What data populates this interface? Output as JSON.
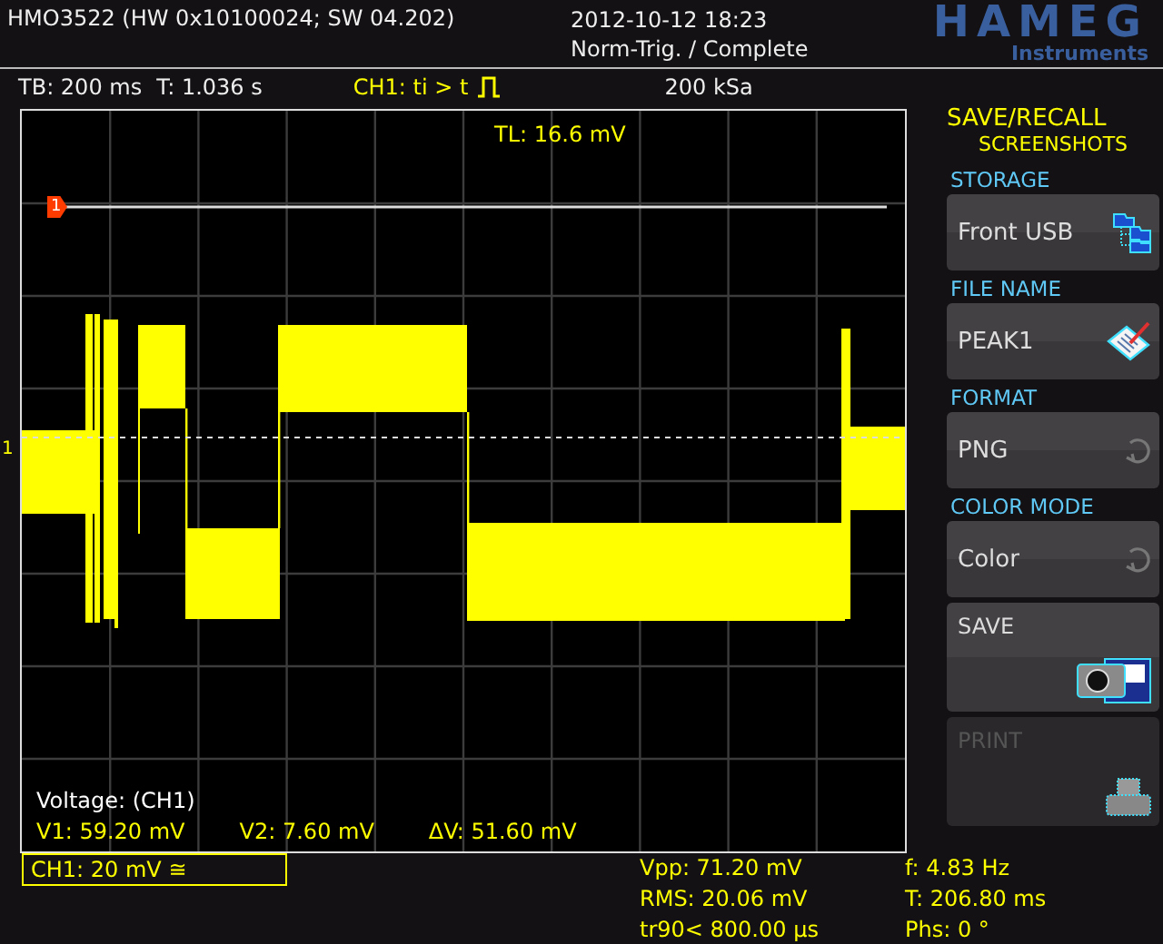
{
  "header": {
    "device": "HMO3522 (HW 0x10100024; SW 04.202)",
    "datetime": "2012-10-12 18:23",
    "status": "Norm-Trig. / Complete",
    "logo": "HAMEG",
    "logo_sub": "Instruments"
  },
  "info": {
    "timebase": "TB: 200 ms",
    "time": "T: 1.036 s",
    "trigger": "CH1: ti > t",
    "sample_rate": "200 kSa"
  },
  "screen": {
    "trigger_level": "TL: 16.6 mV",
    "ref_marker": "1",
    "channel_marker": "1",
    "cursor_title": "Voltage: (CH1)",
    "cursor_readings": [
      "V1: 59.20 mV",
      "V2: 7.60 mV",
      "ΔV: 51.60 mV"
    ]
  },
  "channel_box": "CH1: 20 mV ≅",
  "measurements": [
    "Vpp: 71.20 mV",
    "f: 4.83 Hz",
    "RMS: 20.06 mV",
    "T: 206.80 ms",
    "tr90< 800.00 µs",
    "Phs: 0 °"
  ],
  "menu": {
    "title": "SAVE/RECALL",
    "subtitle": "SCREENSHOTS",
    "items": [
      {
        "kind": "folder",
        "label": "STORAGE",
        "value": "Front USB",
        "disabled": false
      },
      {
        "kind": "filename",
        "label": "FILE NAME",
        "value": "PEAK1",
        "disabled": false
      },
      {
        "kind": "toggle",
        "label": "FORMAT",
        "value": "PNG",
        "disabled": false
      },
      {
        "kind": "toggle",
        "label": "COLOR MODE",
        "value": "Color",
        "disabled": false
      },
      {
        "kind": "save",
        "value": "SAVE",
        "disabled": false
      },
      {
        "kind": "print",
        "value": "PRINT",
        "disabled": true
      }
    ]
  }
}
